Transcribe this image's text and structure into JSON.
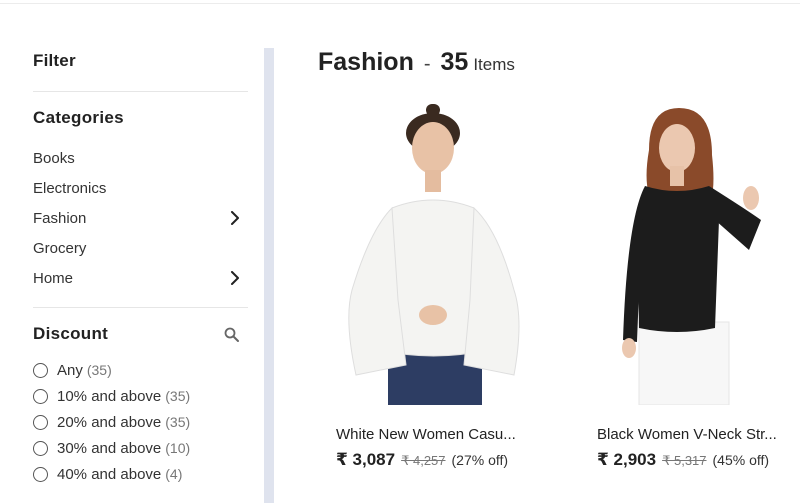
{
  "filter": {
    "title": "Filter"
  },
  "categories": {
    "title": "Categories",
    "items": [
      {
        "label": "Books",
        "has_children": false
      },
      {
        "label": "Electronics",
        "has_children": false
      },
      {
        "label": "Fashion",
        "has_children": true
      },
      {
        "label": "Grocery",
        "has_children": false
      },
      {
        "label": "Home",
        "has_children": true
      }
    ]
  },
  "discount": {
    "title": "Discount",
    "options": [
      {
        "label": "Any",
        "count": "(35)"
      },
      {
        "label": "10% and above",
        "count": "(35)"
      },
      {
        "label": "20% and above",
        "count": "(35)"
      },
      {
        "label": "30% and above",
        "count": "(10)"
      },
      {
        "label": "40% and above",
        "count": "(4)"
      }
    ]
  },
  "heading": {
    "category": "Fashion",
    "dash": "-",
    "count": "35",
    "items_label": "Items"
  },
  "products": [
    {
      "title": "White New Women Casu...",
      "price": "₹ 3,087",
      "mrp": "₹ 4,257",
      "off": "(27% off)",
      "shirt_color": "#f4f4f2"
    },
    {
      "title": "Black Women V-Neck Str...",
      "price": "₹ 2,903",
      "mrp": "₹ 5,317",
      "off": "(45% off)",
      "shirt_color": "#1c1c1c"
    }
  ]
}
